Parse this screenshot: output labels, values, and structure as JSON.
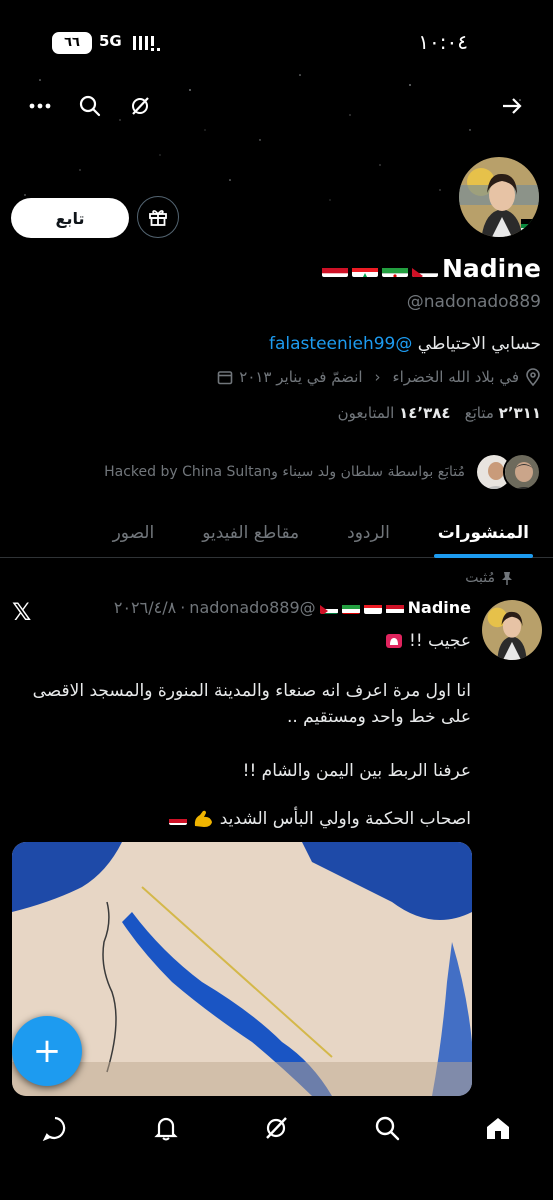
{
  "status_bar": {
    "time": "١٠:٠٤",
    "battery": "٦٦",
    "network": "5G"
  },
  "profile": {
    "follow_label": "تابع",
    "name": "Nadine",
    "handle": "@nadonado889",
    "bio_text": "حسابي الاحتياطي ",
    "bio_mention": "@falasteenieh99",
    "location": "في بلاد الله الخضراء",
    "joined": "انضمّ في يناير ٢٠١٣",
    "following_count": "٢٬٣١١",
    "following_label": "متابَع",
    "followers_count": "١٤٬٣٨٤",
    "followers_label": "المتابعون",
    "followed_by": "مُتابَع بواسطة سلطان ولد سيناء وHacked by China Sultan"
  },
  "tabs": [
    {
      "label": "المنشورات",
      "active": true
    },
    {
      "label": "الردود",
      "active": false
    },
    {
      "label": "مقاطع الفيديو",
      "active": false
    },
    {
      "label": "الصور",
      "active": false
    }
  ],
  "post": {
    "pinned_label": "مُثبت",
    "author_name": "Nadine",
    "author_handle": "@nadonado889",
    "date": "٢٠٢٦/٤/٨",
    "line1": "عجيب !!",
    "line2": "انا اول مرة اعرف انه صنعاء  والمدينة المنورة والمسجد الاقصى على خط واحد ومستقيم ..",
    "line3": "عرفنا الربط بين اليمن والشام !!",
    "line4": "اصحاب الحكمة واولي البأس الشديد"
  },
  "fab_label": "+",
  "colors": {
    "accent": "#1d9bf0",
    "background": "#000000",
    "secondary_text": "#71767b"
  }
}
